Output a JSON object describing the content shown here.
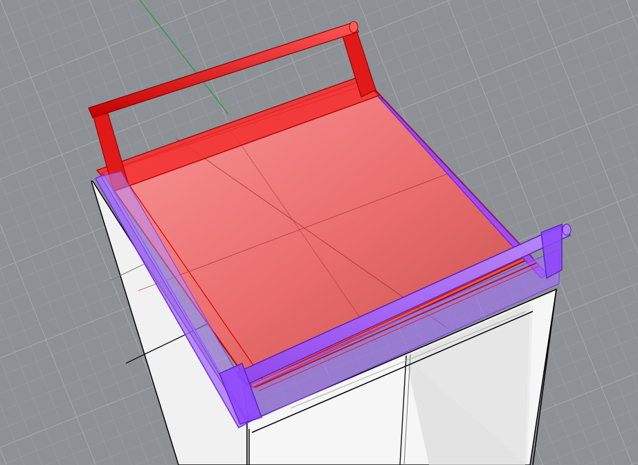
{
  "viewport": {
    "background_color": "#8d9196",
    "grid_minor_color": "#9ca1a6",
    "grid_major_color": "#a9aeb3",
    "axis_y_color": "#2e9a3b"
  },
  "objects": {
    "cabinet": {
      "face_color": "#f4f4f4",
      "shade_color": "#d8d8d8",
      "edge_color": "#000000"
    },
    "tray_red": {
      "color": "#ff3030",
      "edge_color": "#b60000"
    },
    "frame_purple": {
      "color": "#9b4dff",
      "edge_color": "#6d28d9"
    }
  }
}
